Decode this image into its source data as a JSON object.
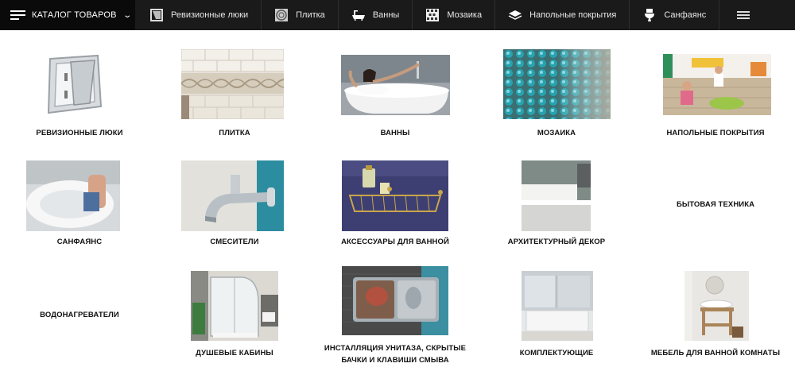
{
  "nav": {
    "catalog_label": "КАТАЛОГ ТОВАРОВ",
    "items": [
      {
        "label": "Ревизионные люки",
        "icon": "hatch-icon"
      },
      {
        "label": "Плитка",
        "icon": "tile-icon"
      },
      {
        "label": "Ванны",
        "icon": "bathtub-icon"
      },
      {
        "label": "Мозаика",
        "icon": "mosaic-icon"
      },
      {
        "label": "Напольные покрытия",
        "icon": "floor-icon"
      },
      {
        "label": "Санфаянс",
        "icon": "toilet-icon"
      }
    ]
  },
  "categories": [
    {
      "label": "РЕВИЗИОННЫЕ ЛЮКИ"
    },
    {
      "label": "ПЛИТКА"
    },
    {
      "label": "ВАННЫ"
    },
    {
      "label": "МОЗАИКА"
    },
    {
      "label": "НАПОЛЬНЫЕ ПОКРЫТИЯ"
    },
    {
      "label": "САНФАЯНС"
    },
    {
      "label": "СМЕСИТЕЛИ"
    },
    {
      "label": "АКСЕССУАРЫ ДЛЯ ВАННОЙ"
    },
    {
      "label": "АРХИТЕКТУРНЫЙ ДЕКОР"
    },
    {
      "label": "БЫТОВАЯ ТЕХНИКА"
    },
    {
      "label": "ВОДОНАГРЕВАТЕЛИ"
    },
    {
      "label": "ДУШЕВЫЕ КАБИНЫ"
    },
    {
      "label": "ИНСТАЛЛЯЦИЯ УНИТАЗА, СКРЫТЫЕ БАЧКИ И КЛАВИШИ СМЫВА"
    },
    {
      "label": "КОМПЛЕКТУЮЩИЕ"
    },
    {
      "label": "МЕБЕЛЬ ДЛЯ ВАННОЙ КОМНАТЫ"
    }
  ]
}
